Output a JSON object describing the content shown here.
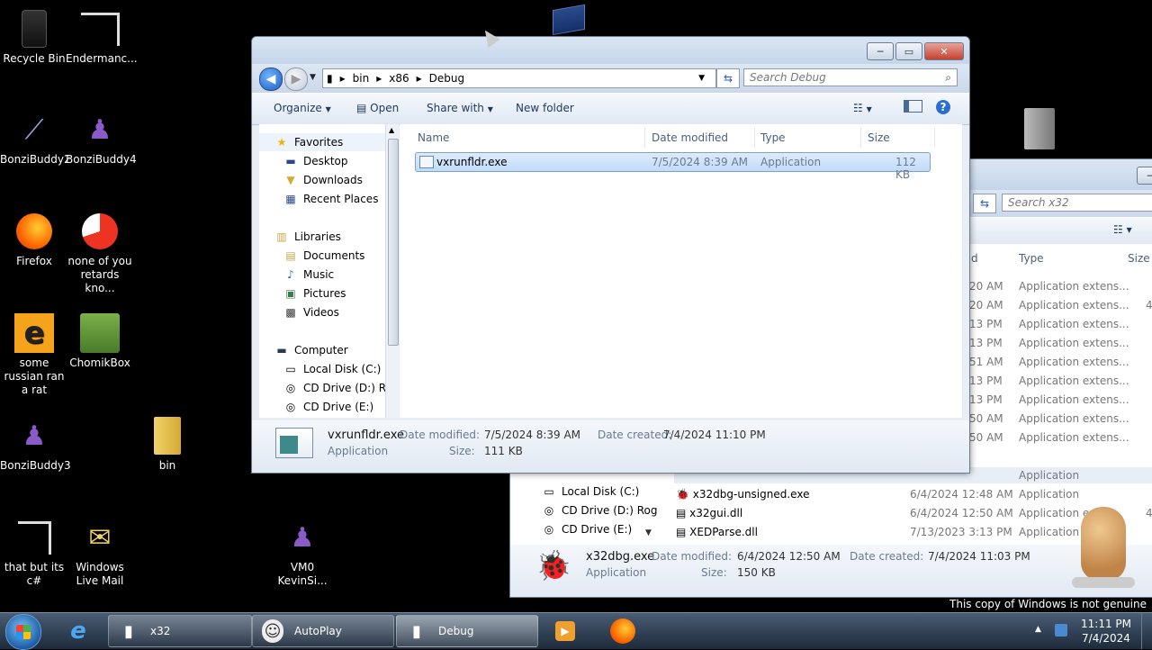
{
  "desktop": {
    "icons": [
      {
        "label": "Recycle Bin",
        "glyph": "▮"
      },
      {
        "label": "Endermanc...",
        "glyph": "▯"
      },
      {
        "label": "BonziBuddy2",
        "glyph": "⟋"
      },
      {
        "label": "BonziBuddy4",
        "glyph": "♟"
      },
      {
        "label": "Firefox",
        "glyph": "🔥"
      },
      {
        "label": "none of you retards kno...",
        "glyph": "◐"
      },
      {
        "label": "some russian ran a rat",
        "glyph": "e"
      },
      {
        "label": "ChomikBox",
        "glyph": "▣"
      },
      {
        "label": "BonziBuddy3",
        "glyph": "♟"
      },
      {
        "label": "bin",
        "glyph": "📁"
      },
      {
        "label": "that but its c#",
        "glyph": "▯"
      },
      {
        "label": "Windows Live Mail",
        "glyph": "✉"
      },
      {
        "label": "VM0 KevinSi...",
        "glyph": "♟"
      }
    ],
    "genuine_notice": "This copy of Windows is not genuine"
  },
  "main_window": {
    "breadcrumb": [
      "bin",
      "x86",
      "Debug"
    ],
    "search_placeholder": "Search Debug",
    "toolbar": {
      "organize": "Organize",
      "open": "Open",
      "share_with": "Share with",
      "new_folder": "New folder"
    },
    "nav": {
      "favorites": "Favorites",
      "favorites_items": [
        "Desktop",
        "Downloads",
        "Recent Places"
      ],
      "libraries": "Libraries",
      "libraries_items": [
        "Documents",
        "Music",
        "Pictures",
        "Videos"
      ],
      "computer": "Computer",
      "computer_items": [
        "Local Disk (C:)",
        "CD Drive (D:) Rog",
        "CD Drive (E:)"
      ]
    },
    "columns": {
      "name": "Name",
      "date": "Date modified",
      "type": "Type",
      "size": "Size"
    },
    "files": [
      {
        "name": "vxrunfldr.exe",
        "date": "7/5/2024 8:39 AM",
        "type": "Application",
        "size": "112 KB"
      }
    ],
    "details": {
      "name": "vxrunfldr.exe",
      "type": "Application",
      "date_modified_label": "Date modified:",
      "date_modified": "7/5/2024 8:39 AM",
      "date_created_label": "Date created:",
      "date_created": "7/4/2024 11:10 PM",
      "size_label": "Size:",
      "size": "111 KB"
    }
  },
  "back_window": {
    "search_placeholder": "Search x32",
    "columns": {
      "type": "Type",
      "size": "Size"
    },
    "partial_rows": [
      {
        "date": "20 AM",
        "type": "Application extens...",
        "size": "4,"
      },
      {
        "date": "20 AM",
        "type": "Application extens..."
      },
      {
        "date": "13 PM",
        "type": "Application extens..."
      },
      {
        "date": "13 PM",
        "type": "Application extens..."
      },
      {
        "date": "51 AM",
        "type": "Application extens..."
      },
      {
        "date": "13 PM",
        "type": "Application extens..."
      },
      {
        "date": "13 PM",
        "type": "Application extens..."
      },
      {
        "date": "50 AM",
        "type": "Application extens..."
      },
      {
        "date": "50 AM",
        "type": "Application extens..."
      }
    ],
    "nav_items": [
      "Local Disk (C:)",
      "CD Drive (D:) Rog",
      "CD Drive (E:)"
    ],
    "files": [
      {
        "name": "x32dbg-unsigned.exe",
        "date": "6/4/2024 12:48 AM",
        "type": "Application"
      },
      {
        "name": "x32gui.dll",
        "date": "6/4/2024 12:50 AM",
        "type": "Application e",
        "size": "4,"
      },
      {
        "name": "XEDParse.dll",
        "date": "7/13/2023 3:13 PM",
        "type": "Application e"
      }
    ],
    "details": {
      "name": "x32dbg.exe",
      "type": "Application",
      "date_modified_label": "Date modified:",
      "date_modified": "6/4/2024 12:50 AM",
      "date_created_label": "Date created:",
      "date_created": "7/4/2024 11:03 PM",
      "size_label": "Size:",
      "size": "150 KB"
    }
  },
  "taskbar": {
    "buttons": [
      {
        "label": "x32"
      },
      {
        "label": "AutoPlay"
      },
      {
        "label": "Debug"
      }
    ],
    "time": "11:11 PM",
    "date": "7/4/2024"
  },
  "colors": {
    "accent": "#3399ff",
    "selection": "#cce4f7",
    "taskbar": "#2a3a50"
  }
}
